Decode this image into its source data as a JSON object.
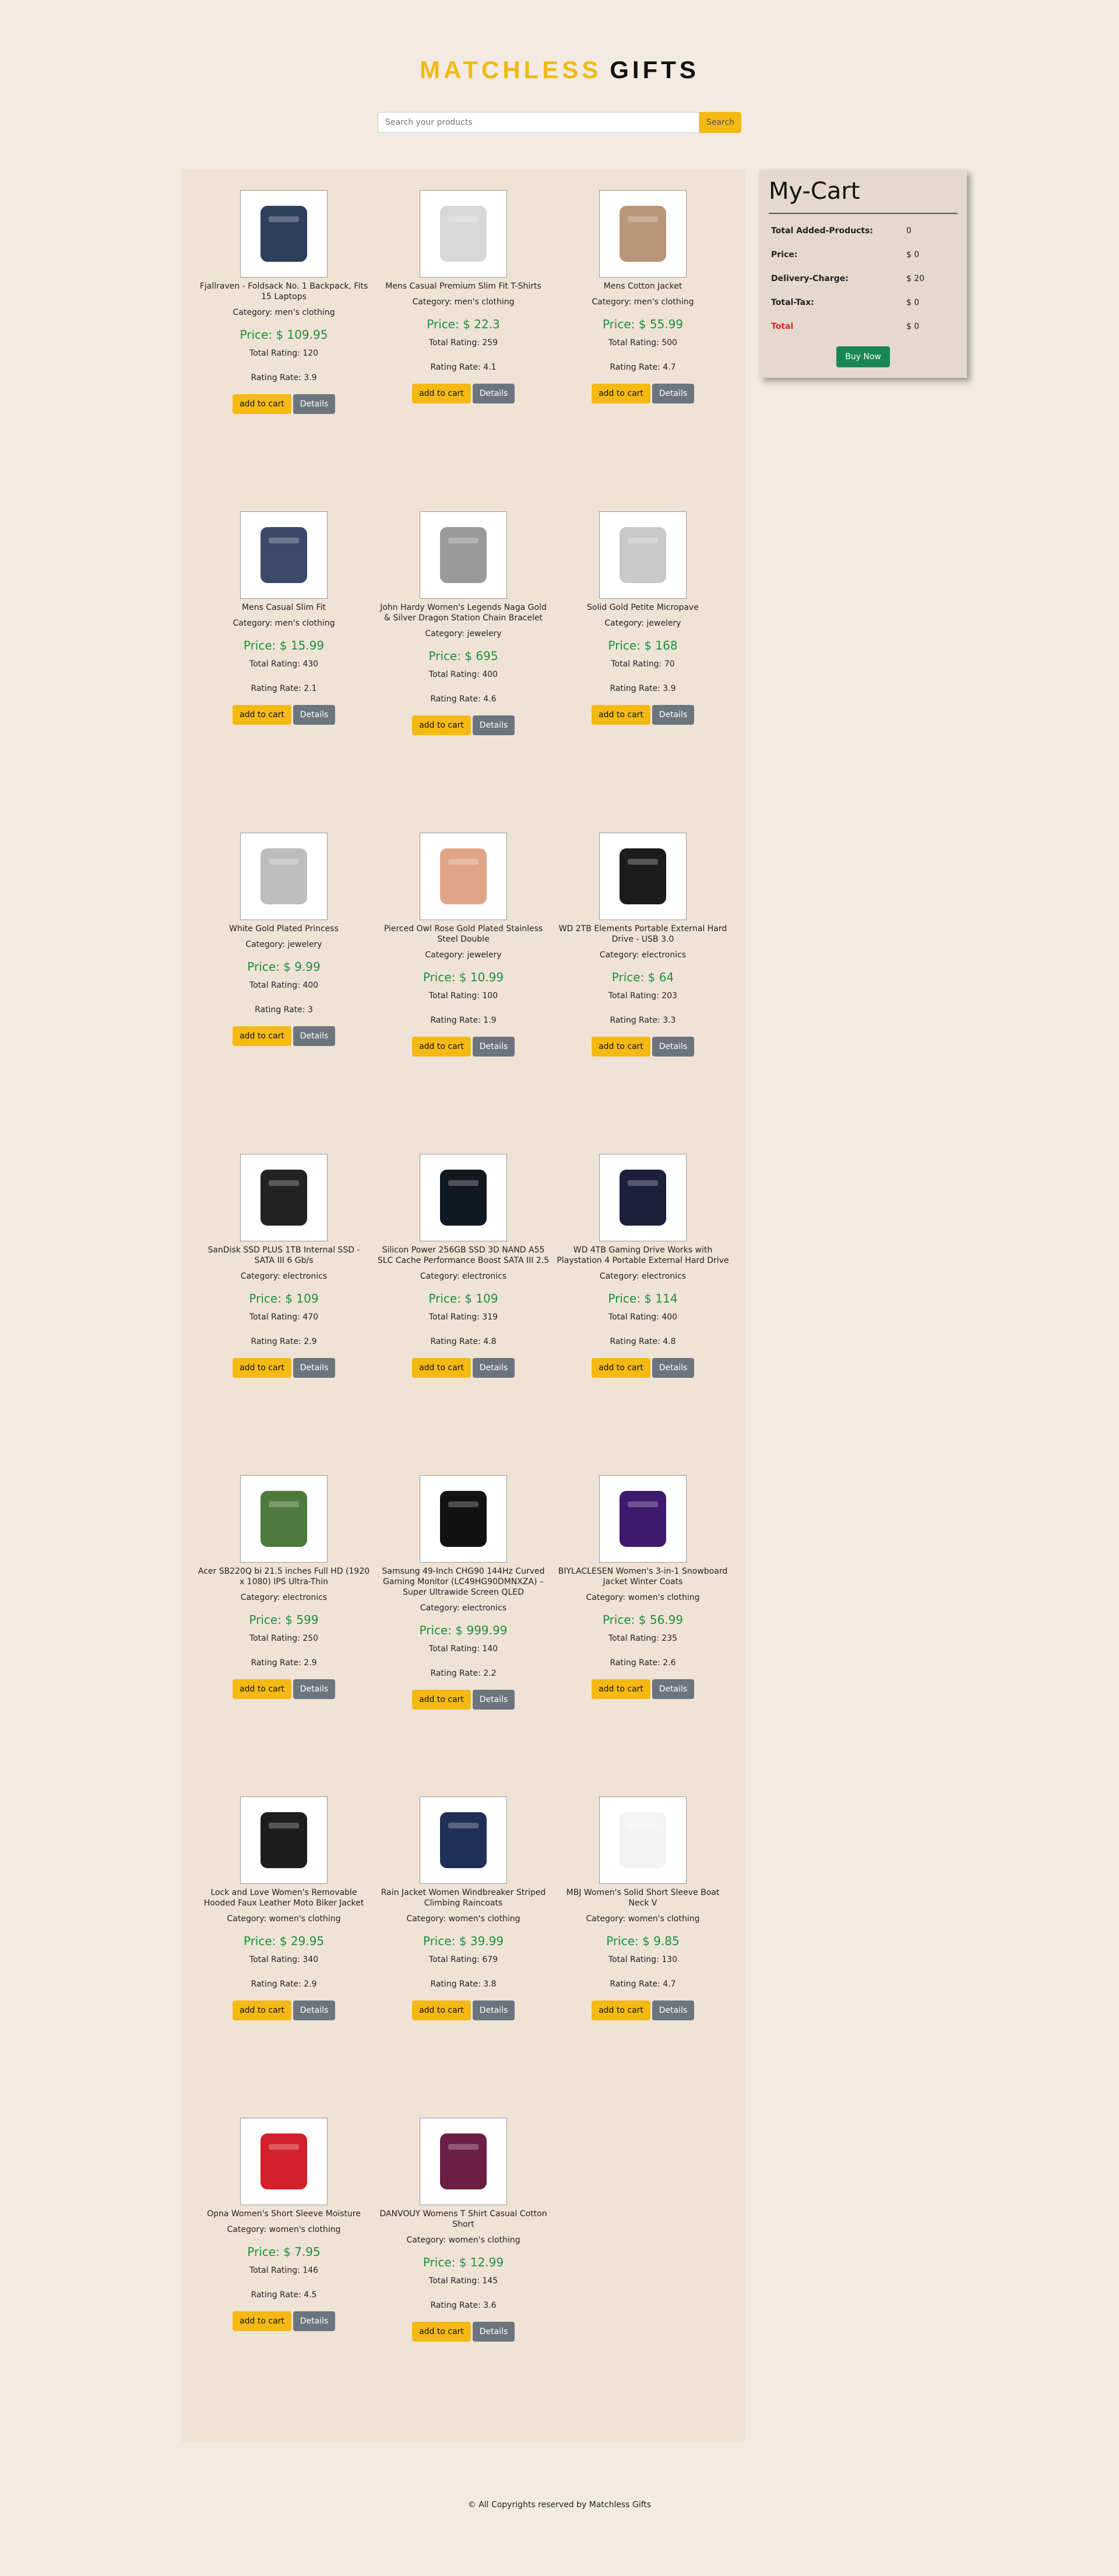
{
  "brand": {
    "part1": "MATCHLESS",
    "part2": "GIFTS"
  },
  "search": {
    "placeholder": "Search your products",
    "button_label": "Search"
  },
  "labels": {
    "category_prefix": "Category: ",
    "price_prefix": "Price: $ ",
    "total_rating_prefix": "Total Rating: ",
    "rating_rate_prefix": "Rating Rate: ",
    "add_to_cart": "add to cart",
    "details": "Details"
  },
  "products": [
    {
      "title": "Fjallraven - Foldsack No. 1 Backpack, Fits 15 Laptops",
      "category": "men's clothing",
      "price": "109.95",
      "total_rating": "120",
      "rating_rate": "3.9",
      "image": "backpack-image",
      "color": "#2e3f5c"
    },
    {
      "title": "Mens Casual Premium Slim Fit T-Shirts",
      "category": "men's clothing",
      "price": "22.3",
      "total_rating": "259",
      "rating_rate": "4.1",
      "image": "tshirt-image",
      "color": "#d8d8d8"
    },
    {
      "title": "Mens Cotton Jacket",
      "category": "men's clothing",
      "price": "55.99",
      "total_rating": "500",
      "rating_rate": "4.7",
      "image": "jacket-image",
      "color": "#b8967a"
    },
    {
      "title": "Mens Casual Slim Fit",
      "category": "men's clothing",
      "price": "15.99",
      "total_rating": "430",
      "rating_rate": "2.1",
      "image": "longsleeve-image",
      "color": "#3b4a6b"
    },
    {
      "title": "John Hardy Women's Legends Naga Gold & Silver Dragon Station Chain Bracelet",
      "category": "jewelery",
      "price": "695",
      "total_rating": "400",
      "rating_rate": "4.6",
      "image": "bracelet-image",
      "color": "#9a9a9a"
    },
    {
      "title": "Solid Gold Petite Micropave",
      "category": "jewelery",
      "price": "168",
      "total_rating": "70",
      "rating_rate": "3.9",
      "image": "ring-image",
      "color": "#c9c9c9"
    },
    {
      "title": "White Gold Plated Princess",
      "category": "jewelery",
      "price": "9.99",
      "total_rating": "400",
      "rating_rate": "3",
      "image": "diamond-ring-image",
      "color": "#bdbdbd"
    },
    {
      "title": "Pierced Owl Rose Gold Plated Stainless Steel Double",
      "category": "jewelery",
      "price": "10.99",
      "total_rating": "100",
      "rating_rate": "1.9",
      "image": "earrings-image",
      "color": "#e0a587"
    },
    {
      "title": "WD 2TB Elements Portable External Hard Drive - USB 3.0",
      "category": "electronics",
      "price": "64",
      "total_rating": "203",
      "rating_rate": "3.3",
      "image": "hard-drive-image",
      "color": "#1c1c1c"
    },
    {
      "title": "SanDisk SSD PLUS 1TB Internal SSD - SATA III 6 Gb/s",
      "category": "electronics",
      "price": "109",
      "total_rating": "470",
      "rating_rate": "2.9",
      "image": "ssd-sandisk-image",
      "color": "#222222"
    },
    {
      "title": "Silicon Power 256GB SSD 3D NAND A55 SLC Cache Performance Boost SATA III 2.5",
      "category": "electronics",
      "price": "109",
      "total_rating": "319",
      "rating_rate": "4.8",
      "image": "ssd-silicon-image",
      "color": "#101820"
    },
    {
      "title": "WD 4TB Gaming Drive Works with Playstation 4 Portable External Hard Drive",
      "category": "electronics",
      "price": "114",
      "total_rating": "400",
      "rating_rate": "4.8",
      "image": "gaming-drive-image",
      "color": "#1b1f3a"
    },
    {
      "title": "Acer SB220Q bi 21.5 inches Full HD (1920 x 1080) IPS Ultra-Thin",
      "category": "electronics",
      "price": "599",
      "total_rating": "250",
      "rating_rate": "2.9",
      "image": "monitor-image",
      "color": "#4d7a3c"
    },
    {
      "title": "Samsung 49-Inch CHG90 144Hz Curved Gaming Monitor (LC49HG90DMNXZA) – Super Ultrawide Screen QLED",
      "category": "electronics",
      "price": "999.99",
      "total_rating": "140",
      "rating_rate": "2.2",
      "image": "curved-monitor-image",
      "color": "#111111"
    },
    {
      "title": "BIYLACLESEN Women's 3-in-1 Snowboard Jacket Winter Coats",
      "category": "women's clothing",
      "price": "56.99",
      "total_rating": "235",
      "rating_rate": "2.6",
      "image": "purple-jacket-image",
      "color": "#3d1a6b"
    },
    {
      "title": "Lock and Love Women's Removable Hooded Faux Leather Moto Biker Jacket",
      "category": "women's clothing",
      "price": "29.95",
      "total_rating": "340",
      "rating_rate": "2.9",
      "image": "biker-jacket-image",
      "color": "#1d1d1d"
    },
    {
      "title": "Rain Jacket Women Windbreaker Striped Climbing Raincoats",
      "category": "women's clothing",
      "price": "39.99",
      "total_rating": "679",
      "rating_rate": "3.8",
      "image": "rain-jacket-image",
      "color": "#1f2f55"
    },
    {
      "title": "MBJ Women's Solid Short Sleeve Boat Neck V",
      "category": "women's clothing",
      "price": "9.85",
      "total_rating": "130",
      "rating_rate": "4.7",
      "image": "white-top-image",
      "color": "#f4f4f4"
    },
    {
      "title": "Opna Women's Short Sleeve Moisture",
      "category": "women's clothing",
      "price": "7.95",
      "total_rating": "146",
      "rating_rate": "4.5",
      "image": "red-shirt-image",
      "color": "#d4202c"
    },
    {
      "title": "DANVOUY Womens T Shirt Casual Cotton Short",
      "category": "women's clothing",
      "price": "12.99",
      "total_rating": "145",
      "rating_rate": "3.6",
      "image": "maroon-shirt-image",
      "color": "#6b1f45"
    }
  ],
  "cart": {
    "title": "My-Cart",
    "rows": [
      {
        "label": "Total Added-Products:",
        "value": "0"
      },
      {
        "label": "Price:",
        "value": "$ 0"
      },
      {
        "label": "Delivery-Charge:",
        "value": "$ 20"
      },
      {
        "label": "Total-Tax:",
        "value": "$ 0"
      },
      {
        "label": "Total",
        "value": "$ 0"
      }
    ],
    "buy_label": "Buy Now"
  },
  "footer": {
    "text": "© All Copyrights reserved by Matchless Gifts"
  },
  "colors": {
    "accent": "#f5b914",
    "price": "#1e8f40",
    "buy": "#198754",
    "details": "#6c757d",
    "total": "#d9232e"
  }
}
